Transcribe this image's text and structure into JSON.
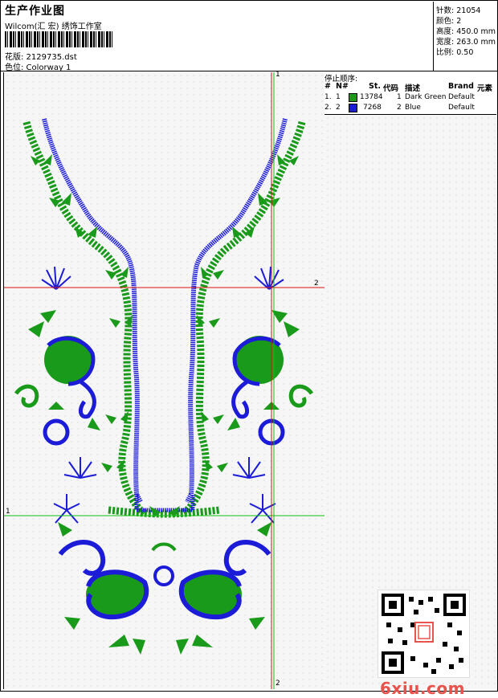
{
  "header": {
    "title": "生产作业图",
    "company": "Wilcom(汇 宏) 绣饰工作室",
    "design_file": "花版: 2129735.dst",
    "colorway": "色位: Colorway 1"
  },
  "stats": [
    {
      "label": "针数:",
      "value": "21054"
    },
    {
      "label": "颜色:",
      "value": "2"
    },
    {
      "label": "高度:",
      "value": "450.0 mm"
    },
    {
      "label": "宽度:",
      "value": "263.0 mm"
    },
    {
      "label": "比例:",
      "value": "0.50"
    }
  ],
  "stop_sequence": {
    "title": "停止顺序:",
    "columns": [
      "#",
      "N#",
      "St.",
      "代码",
      "描述",
      "Brand",
      "元素"
    ],
    "rows": [
      {
        "num": "1.",
        "n": "1",
        "color": "#1a9a1a",
        "stitches": "13784",
        "code": "1",
        "desc": "Dark Green",
        "brand": "Default"
      },
      {
        "num": "2.",
        "n": "2",
        "color": "#1b1bd8",
        "stitches": "7268",
        "code": "2",
        "desc": "Blue",
        "brand": "Default"
      }
    ]
  },
  "axes": {
    "v_top": "1",
    "v_bottom": "2",
    "h_red": "2",
    "h_green": "1"
  },
  "watermark": "6xiu.com",
  "colors": {
    "green": "#1a9a1a",
    "blue": "#1b1bd8",
    "red_axis": "#e01010",
    "green_axis": "#10c010"
  }
}
